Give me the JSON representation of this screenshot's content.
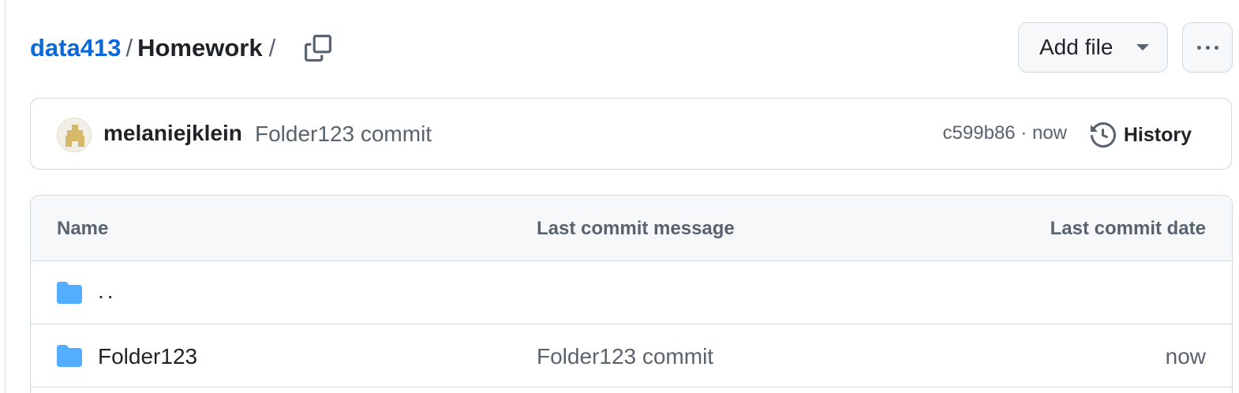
{
  "breadcrumb": {
    "repo": "data413",
    "separator": "/",
    "directory": "Homework",
    "trailing": "/"
  },
  "toolbar": {
    "add_file_label": "Add file",
    "more_label": "More options"
  },
  "commit": {
    "author": "melaniejklein",
    "message": "Folder123 commit",
    "hash": "c599b86",
    "separator": " · ",
    "time": "now",
    "history_label": "History"
  },
  "table": {
    "headers": {
      "name": "Name",
      "message": "Last commit message",
      "date": "Last commit date"
    },
    "rows": [
      {
        "name": "..",
        "message": "",
        "date": "",
        "icon": "folder-icon"
      },
      {
        "name": "Folder123",
        "message": "Folder123 commit",
        "date": "now",
        "icon": "folder-icon"
      }
    ]
  },
  "colors": {
    "link": "#0969da",
    "folder": "#54aeff",
    "muted": "#59636e",
    "border": "#d1d9e0"
  }
}
